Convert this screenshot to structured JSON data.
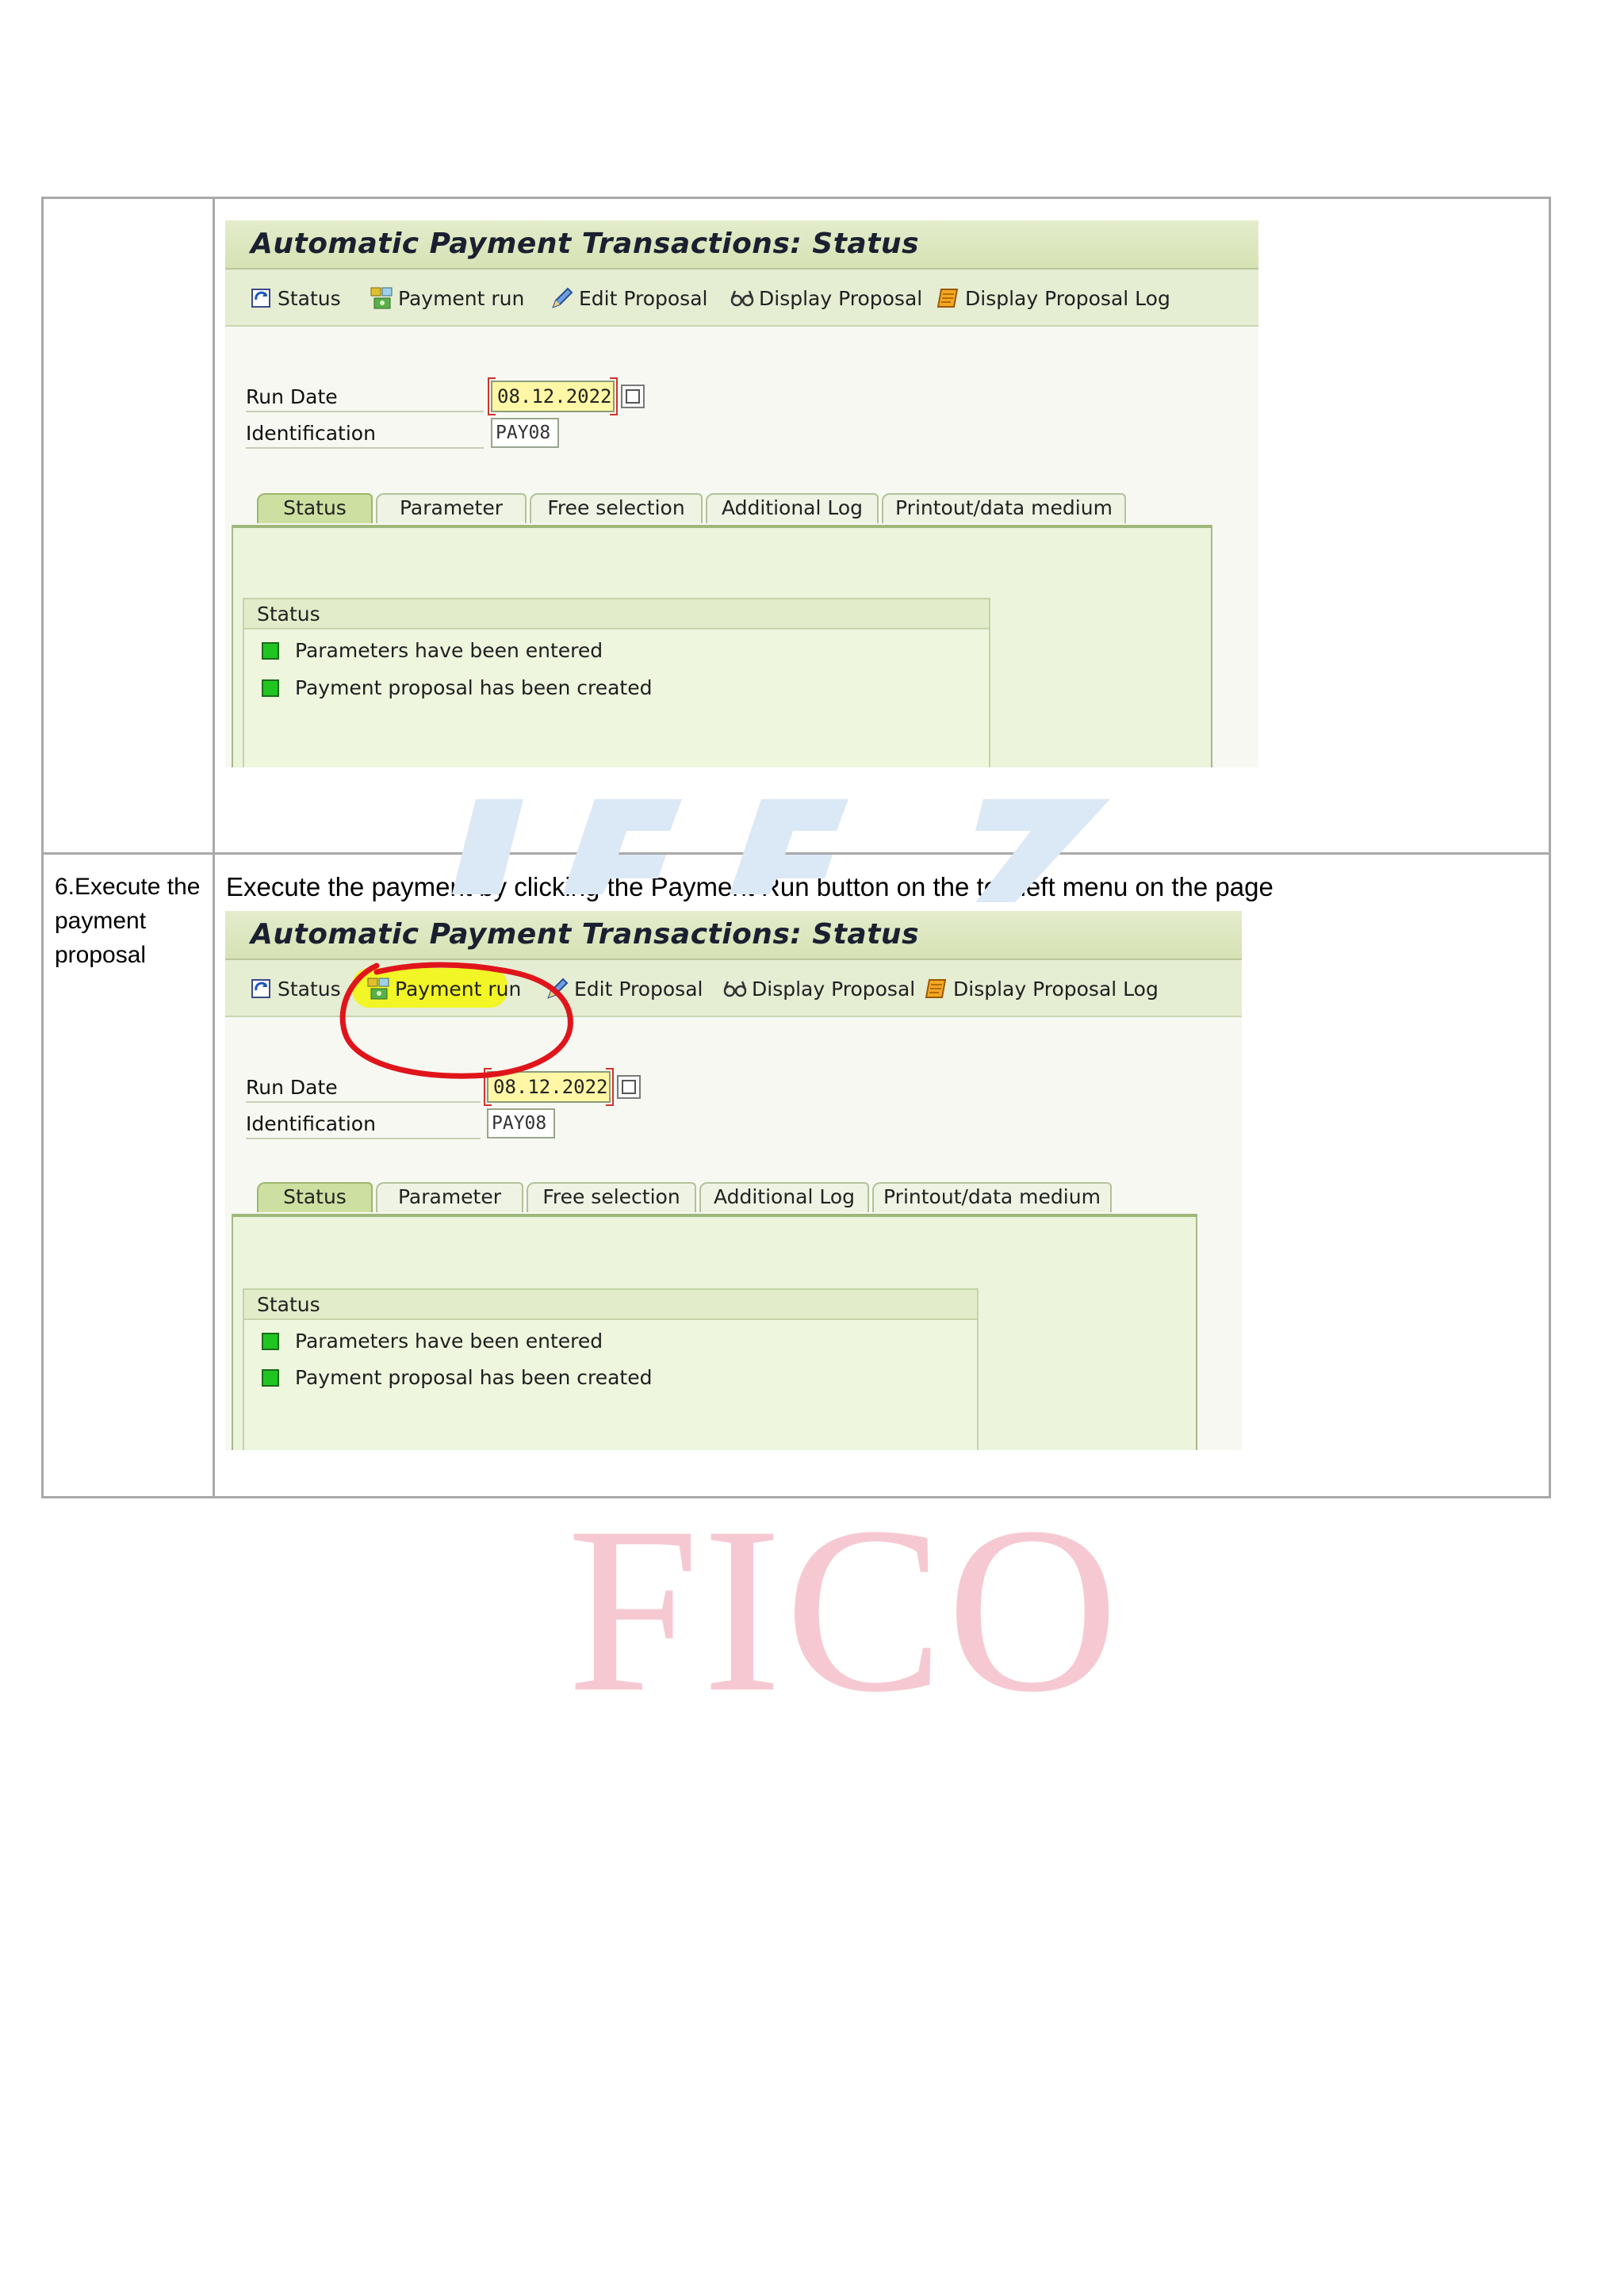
{
  "watermark": {
    "text": "FICO"
  },
  "step": {
    "label": "6.Execute the payment proposal",
    "instruction": "Execute the payment by clicking the Payment Run button on the top left menu on the page"
  },
  "screen": {
    "title": "Automatic Payment Transactions: Status",
    "toolbar": {
      "status": "Status",
      "payment_run": "Payment run",
      "edit_proposal": "Edit Proposal",
      "display_proposal": "Display Proposal",
      "display_proposal_log": "Display Proposal Log"
    },
    "fields": {
      "run_date_label": "Run Date",
      "run_date_value": "08.12.2022",
      "identification_label": "Identification",
      "identification_value": "PAY08"
    },
    "tabs": [
      "Status",
      "Parameter",
      "Free selection",
      "Additional Log",
      "Printout/data medium"
    ],
    "active_tab": "Status",
    "status_group": {
      "title": "Status",
      "items": [
        "Parameters have been entered",
        "Payment proposal has been created"
      ]
    },
    "colors": {
      "led": "#22c422",
      "highlight": "#f2f51c",
      "annotation": "#e0151b"
    }
  }
}
